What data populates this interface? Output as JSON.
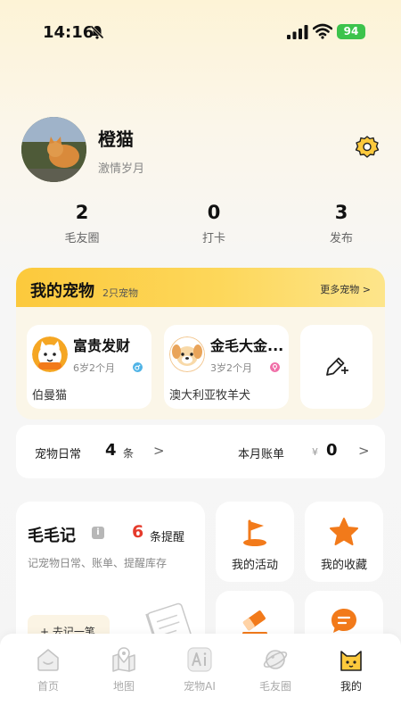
{
  "status": {
    "time": "14:16",
    "battery": "94"
  },
  "profile": {
    "name": "橙猫",
    "subtitle": "激情岁月"
  },
  "stats": [
    {
      "value": "2",
      "label": "毛友圈"
    },
    {
      "value": "0",
      "label": "打卡"
    },
    {
      "value": "3",
      "label": "发布"
    }
  ],
  "pets": {
    "title": "我的宠物",
    "count": "2只宠物",
    "more": "更多宠物 >",
    "items": [
      {
        "name": "富贵发财",
        "age": "6岁2个月",
        "breed": "伯曼猫",
        "gender": "male"
      },
      {
        "name": "金毛大金...",
        "age": "3岁2个月",
        "breed": "澳大利亚牧羊犬",
        "gender": "female"
      }
    ]
  },
  "records": {
    "daily_label": "宠物日常",
    "daily_count": "4",
    "daily_unit": "条",
    "arrow": ">",
    "bill_label": "本月账单",
    "currency": "¥",
    "bill_amount": "0"
  },
  "diary": {
    "title": "毛毛记",
    "info": "i",
    "remind_count": "6",
    "remind_label": "条提醒",
    "desc": "记宠物日常、账单、提醒库存",
    "add_label": "+ 去记一笔"
  },
  "tiles": [
    {
      "label": "我的活动",
      "icon": "flag-icon"
    },
    {
      "label": "我的收藏",
      "icon": "star-icon"
    },
    {
      "label": "",
      "icon": "eraser-icon"
    },
    {
      "label": "",
      "icon": "message-icon"
    }
  ],
  "tabs": [
    {
      "label": "首页",
      "icon": "home-icon"
    },
    {
      "label": "地图",
      "icon": "map-icon"
    },
    {
      "label": "宠物AI",
      "icon": "ai-icon"
    },
    {
      "label": "毛友圈",
      "icon": "planet-icon"
    },
    {
      "label": "我的",
      "icon": "cat-face-icon",
      "active": true
    }
  ],
  "colors": {
    "accent": "#FCC93C",
    "orange": "#F27A1A",
    "remind": "#E53B2C",
    "battery": "#3CC34C"
  }
}
